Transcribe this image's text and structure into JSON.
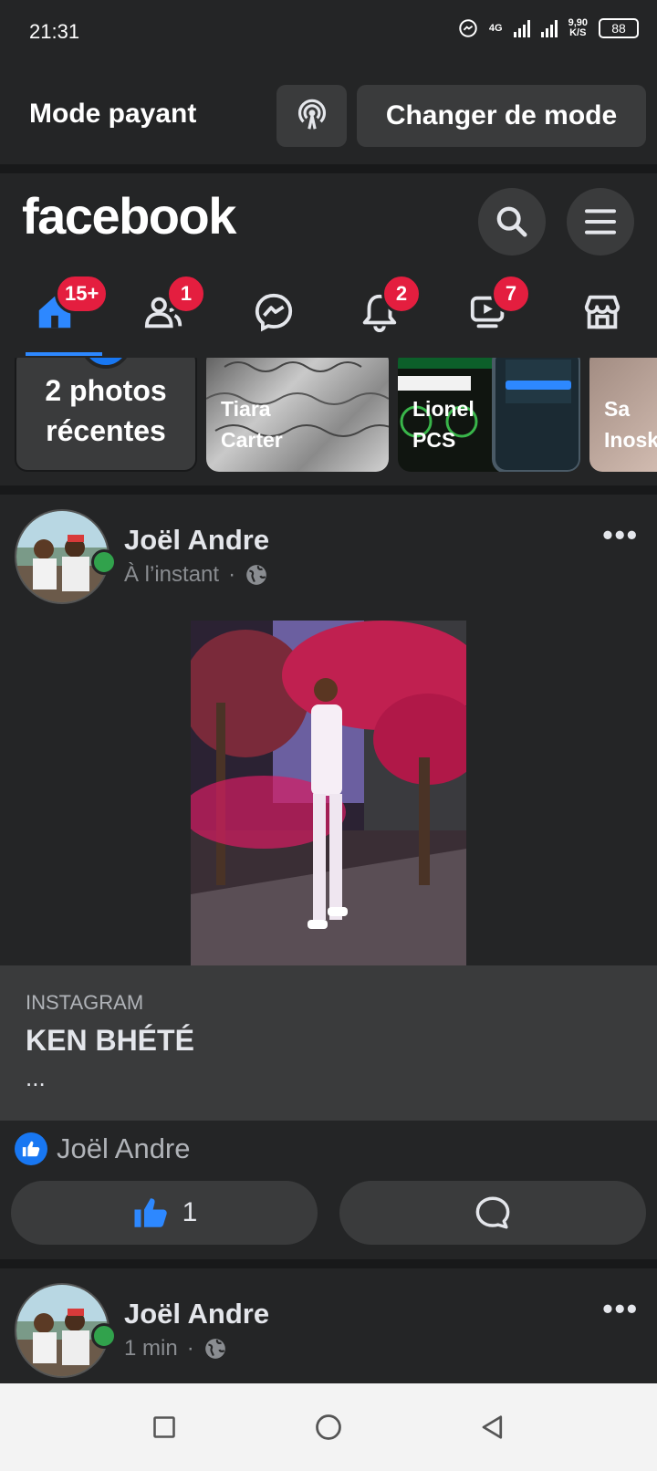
{
  "status_bar": {
    "time": "21:31",
    "network_type": "4G",
    "speed_value": "9,90",
    "speed_unit": "K/S",
    "battery": "88"
  },
  "mode_bar": {
    "title": "Mode payant",
    "switch_label": "Changer de mode"
  },
  "header": {
    "logo": "facebook",
    "nav": [
      {
        "name": "home",
        "badge": "15+"
      },
      {
        "name": "friends",
        "badge": "1"
      },
      {
        "name": "messenger",
        "badge": ""
      },
      {
        "name": "notifications",
        "badge": "2"
      },
      {
        "name": "watch",
        "badge": "7"
      },
      {
        "name": "marketplace",
        "badge": ""
      }
    ]
  },
  "stories": [
    {
      "label": "2 photos récentes"
    },
    {
      "label": "Tiara Carter"
    },
    {
      "label": "Lionel PCS"
    },
    {
      "label": "Sa Inosk"
    }
  ],
  "post1": {
    "author": "Joël Andre",
    "time": "À l’instant",
    "link_source": "INSTAGRAM",
    "link_title": "KEN BHÉTÉ",
    "link_desc": "...",
    "liked_by": "Joël Andre",
    "like_count": "1"
  },
  "post2": {
    "author": "Joël Andre",
    "time": "1 min"
  },
  "colors": {
    "accent": "#1877f2",
    "badge": "#e41e3f",
    "online": "#31a24c",
    "background": "#242526"
  }
}
